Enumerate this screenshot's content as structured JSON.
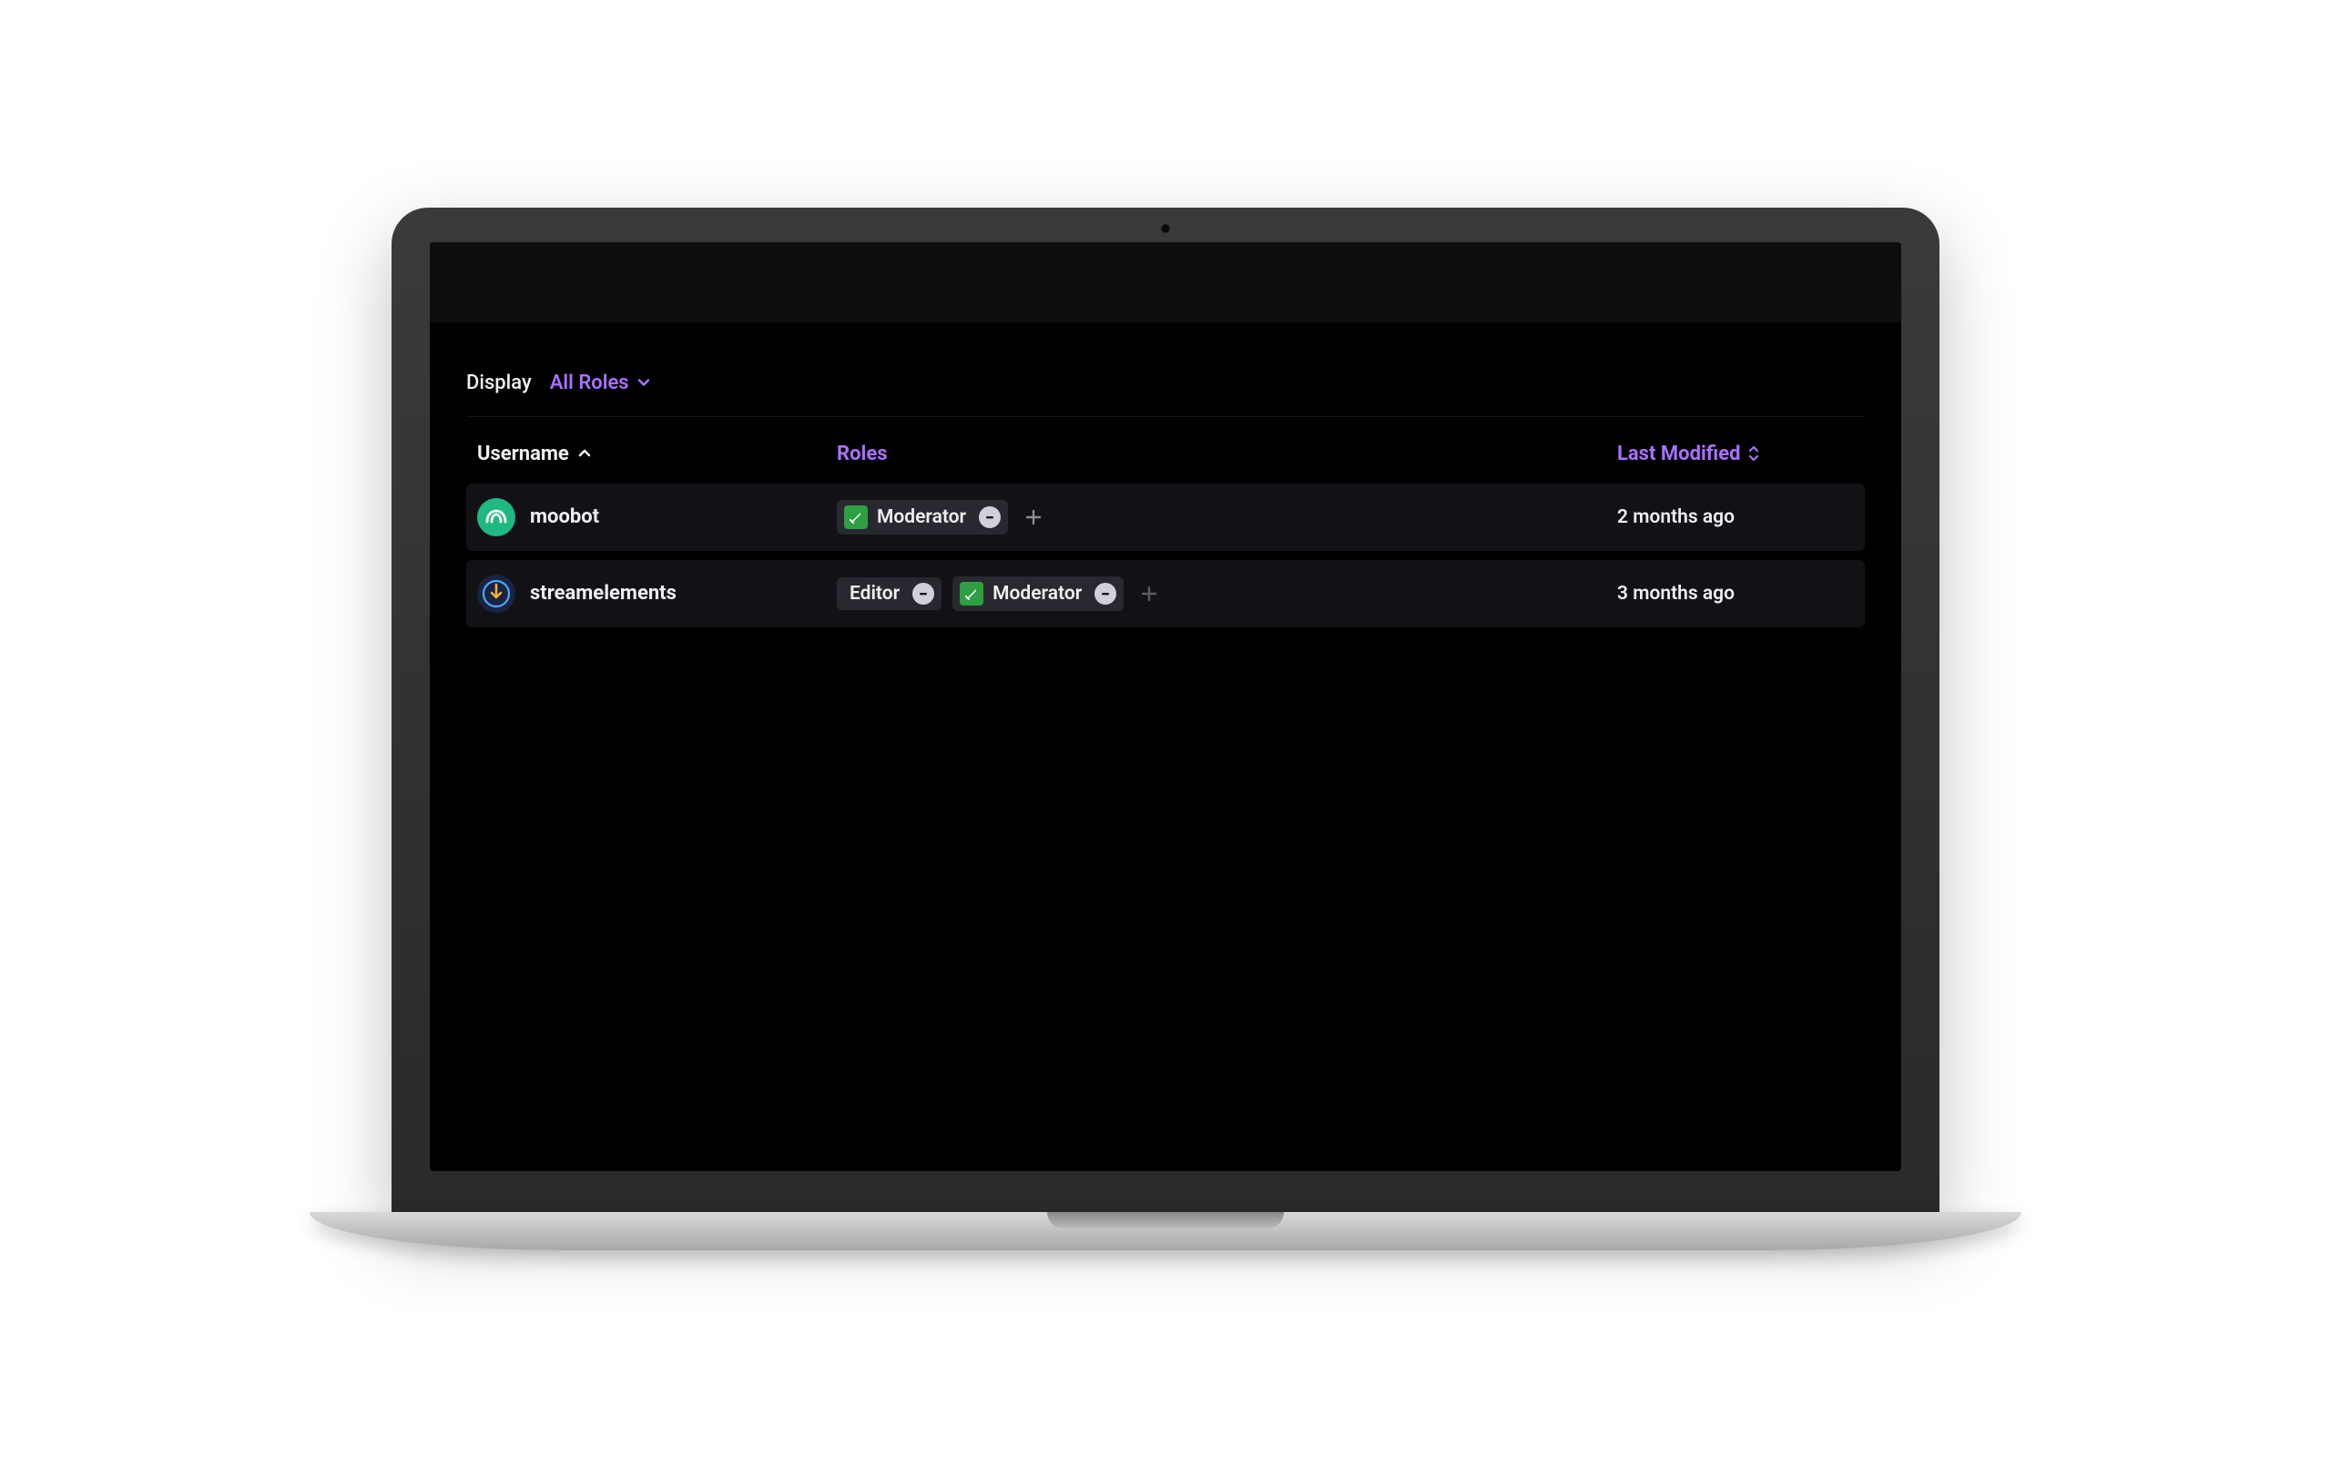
{
  "filter": {
    "display_label": "Display",
    "dropdown_label": "All Roles"
  },
  "columns": {
    "username": "Username",
    "roles": "Roles",
    "last_modified": "Last Modified"
  },
  "roles": {
    "moderator": "Moderator",
    "editor": "Editor"
  },
  "rows": [
    {
      "username": "moobot",
      "avatar_type": "moobot",
      "roles": [
        {
          "type": "moderator",
          "has_icon": true
        }
      ],
      "last_modified": "2 months ago"
    },
    {
      "username": "streamelements",
      "avatar_type": "se",
      "roles": [
        {
          "type": "editor",
          "has_icon": false
        },
        {
          "type": "moderator",
          "has_icon": true
        }
      ],
      "last_modified": "3 months ago"
    }
  ],
  "colors": {
    "accent": "#a970ff",
    "moderator_badge": "#2ea043",
    "row_bg": "#121216"
  }
}
